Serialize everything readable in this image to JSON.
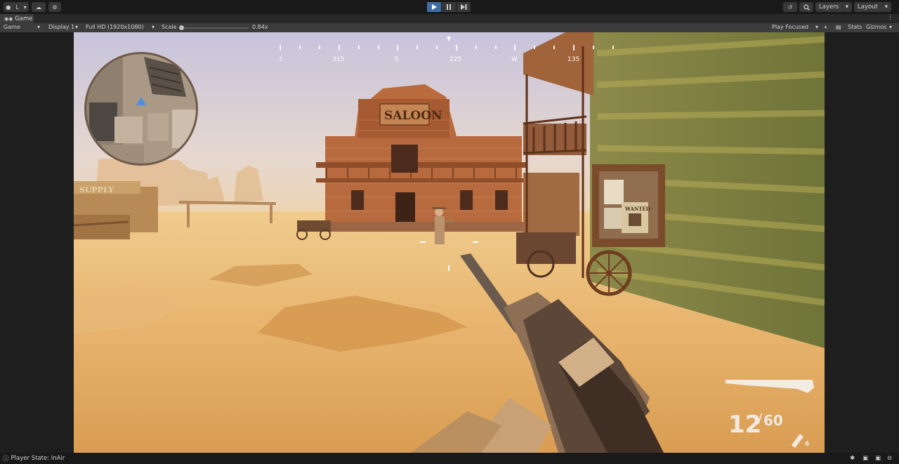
{
  "toolbar": {
    "account_label": "L",
    "layers_label": "Layers",
    "layout_label": "Layout",
    "icons": [
      "account-icon",
      "cloud-icon",
      "settings-icon",
      "play-icon",
      "pause-icon",
      "step-icon",
      "history-icon",
      "search-icon",
      "chevron-down-icon"
    ]
  },
  "tab": {
    "label": "Game",
    "icon": "gamepad-icon"
  },
  "game_view": {
    "mode": "Game",
    "display": "Display 1",
    "resolution": "Full HD (1920x1080)",
    "scale_label": "Scale",
    "scale_value": "0.84x",
    "play_mode": "Play Focused",
    "stats_label": "Stats",
    "gizmos_label": "Gizmos"
  },
  "hud": {
    "compass": {
      "labels": [
        "315",
        "S",
        "225",
        "W",
        "135"
      ]
    },
    "ammo_loaded": "12",
    "ammo_reserve": "60",
    "grenades": "6",
    "sign_saloon": "SALOON",
    "sign_supply": "SUPPLY",
    "poster_title": "WANTED"
  },
  "status": {
    "player_state": "Player State: InAir"
  },
  "colors": {
    "accent": "#3f6ea5",
    "editor_bg": "#191919",
    "sky": "#d9d2d8",
    "sand": "#e6b46a",
    "wood": "#a8552e",
    "hud_text": "#f1e9df"
  }
}
